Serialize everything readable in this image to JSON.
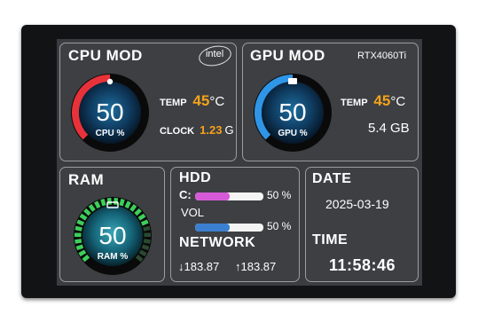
{
  "cpu": {
    "title": "CPU MOD",
    "brand": "intel",
    "value": "50",
    "unit": "CPU %",
    "load": 0.5,
    "temp_label": "TEMP",
    "temp_value": "45",
    "temp_unit": "°C",
    "clock_label": "CLOCK",
    "clock_value": "1.23",
    "clock_unit": "G",
    "arc_color": "#e8323a"
  },
  "gpu": {
    "title": "GPU MOD",
    "model": "RTX4060Ti",
    "value": "50",
    "unit": "GPU %",
    "load": 0.5,
    "temp_label": "TEMP",
    "temp_value": "45",
    "temp_unit": "°C",
    "memory": "5.4 GB",
    "arc_color": "#2f95e6"
  },
  "ram": {
    "title": "RAM",
    "value": "50",
    "unit": "RAM %",
    "load": 0.5,
    "arc_color": "#3ccf5a"
  },
  "hdd": {
    "title": "HDD",
    "drive_c_label": "C:",
    "drive_c_percent": "50 %",
    "drive_c_fill": 0.5,
    "drive_c_color": "#d65ad8",
    "vol_label": "VOL",
    "vol_percent": "50 %",
    "vol_fill": 0.5,
    "vol_color": "#3a7fd0"
  },
  "network": {
    "title": "NETWORK",
    "download": "183.87",
    "upload": "183.87"
  },
  "date": {
    "title": "DATE",
    "value": "2025-03-19"
  },
  "time": {
    "title": "TIME",
    "value": "11:58:46"
  },
  "colors": {
    "accent_orange": "#f4a21a",
    "panel_border": "#9a9ca0"
  }
}
